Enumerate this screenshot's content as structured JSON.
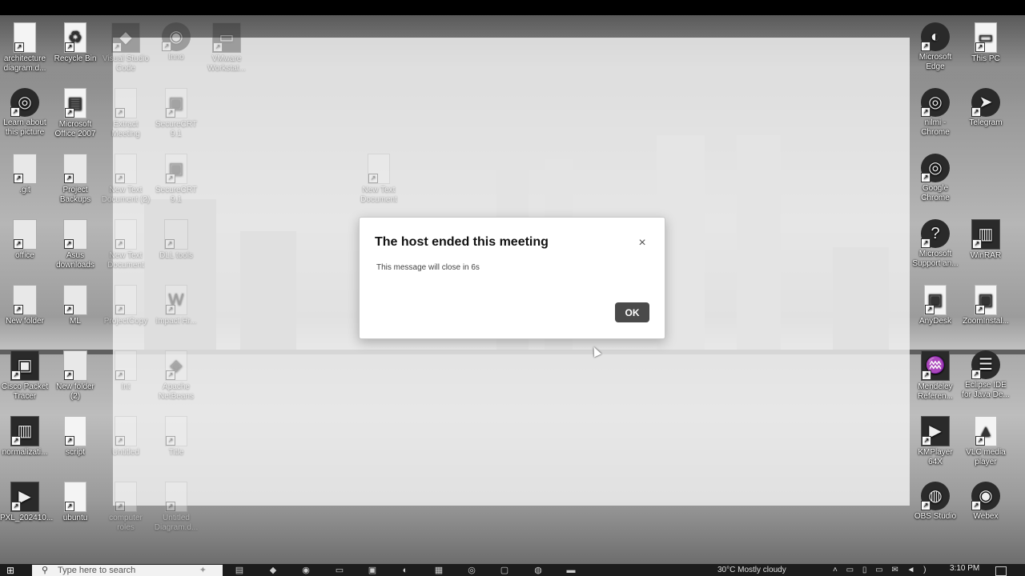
{
  "dialog": {
    "title": "The host ended this meeting",
    "message": "This message will close in 6s",
    "ok_label": "OK",
    "close_glyph": "×"
  },
  "desktop_icons_left": [
    {
      "label": "architecture diagram.d...",
      "icon": "document-icon"
    },
    {
      "label": "Recycle Bin",
      "icon": "recycle-bin-icon"
    },
    {
      "label": "Learn about this picture",
      "icon": "info-camera-icon"
    },
    {
      "label": "Microsoft Office 2007",
      "icon": "office-icon"
    },
    {
      "label": ".git",
      "icon": "folder-icon"
    },
    {
      "label": "Project Backups",
      "icon": "folder-icon"
    },
    {
      "label": "office",
      "icon": "folder-icon"
    },
    {
      "label": "Asus downloads",
      "icon": "folder-icon"
    },
    {
      "label": "New folder",
      "icon": "folder-icon"
    },
    {
      "label": "ML",
      "icon": "folder-icon"
    },
    {
      "label": "Cisco Packet Tracer",
      "icon": "cisco-icon"
    },
    {
      "label": "New folder (2)",
      "icon": "folder-icon"
    },
    {
      "label": "normalizati...",
      "icon": "image-file-icon"
    },
    {
      "label": "script",
      "icon": "document-icon"
    },
    {
      "label": "PXL_202410...",
      "icon": "video-file-icon"
    },
    {
      "label": "ubuntu",
      "icon": "document-icon"
    }
  ],
  "desktop_icons_faded": [
    {
      "label": "Visual Studio Code",
      "icon": "vscode-icon"
    },
    {
      "label": "Inno",
      "icon": "inno-setup-icon"
    },
    {
      "label": "VMware Workstat...",
      "icon": "vmware-icon"
    },
    {
      "label": "Extract Meeting",
      "icon": "document-icon"
    },
    {
      "label": "SecureCRT 9.1",
      "icon": "securecrt-icon"
    },
    {
      "label": "New Text Document",
      "icon": "text-file-icon"
    },
    {
      "label": "SecureCRT 9.1",
      "icon": "securecrt-icon"
    },
    {
      "label": "New Text Document (2)",
      "icon": "text-file-icon"
    },
    {
      "label": "New Text Document",
      "icon": "text-file-icon"
    },
    {
      "label": "DLL tools",
      "icon": "folder-icon"
    },
    {
      "label": "ProjectCopy",
      "icon": "document-icon"
    },
    {
      "label": "Impact Hr...",
      "icon": "word-icon"
    },
    {
      "label": "Int",
      "icon": "document-icon"
    },
    {
      "label": "Apache NetBeans",
      "icon": "netbeans-icon"
    },
    {
      "label": "Untitled",
      "icon": "document-icon"
    },
    {
      "label": "Title",
      "icon": "document-icon"
    },
    {
      "label": "computer roles",
      "icon": "document-icon"
    },
    {
      "label": "Untitled Diagram.d...",
      "icon": "document-icon"
    }
  ],
  "desktop_icons_right": [
    {
      "label": "Microsoft Edge",
      "icon": "edge-icon"
    },
    {
      "label": "This PC",
      "icon": "computer-icon"
    },
    {
      "label": "nilmi - Chrome",
      "icon": "chrome-icon"
    },
    {
      "label": "Telegram",
      "icon": "telegram-icon"
    },
    {
      "label": "Google Chrome",
      "icon": "chrome-icon"
    },
    {
      "label": "Microsoft Support an...",
      "icon": "help-icon"
    },
    {
      "label": "WinRAR",
      "icon": "winrar-icon"
    },
    {
      "label": "AnyDesk",
      "icon": "anydesk-icon"
    },
    {
      "label": "ZoomInstal...",
      "icon": "zoom-installer-icon"
    },
    {
      "label": "Mendeley Referen...",
      "icon": "mendeley-icon"
    },
    {
      "label": "Eclipse IDE for Java De...",
      "icon": "eclipse-icon"
    },
    {
      "label": "KMPlayer 64X",
      "icon": "kmplayer-icon"
    },
    {
      "label": "VLC media player",
      "icon": "vlc-icon"
    },
    {
      "label": "OBS Studio",
      "icon": "obs-icon"
    },
    {
      "label": "Webex",
      "icon": "webex-icon"
    }
  ],
  "taskbar": {
    "search_placeholder": "Type here to search",
    "weather": "30°C  Mostly cloudy",
    "time": "3:10 PM"
  }
}
